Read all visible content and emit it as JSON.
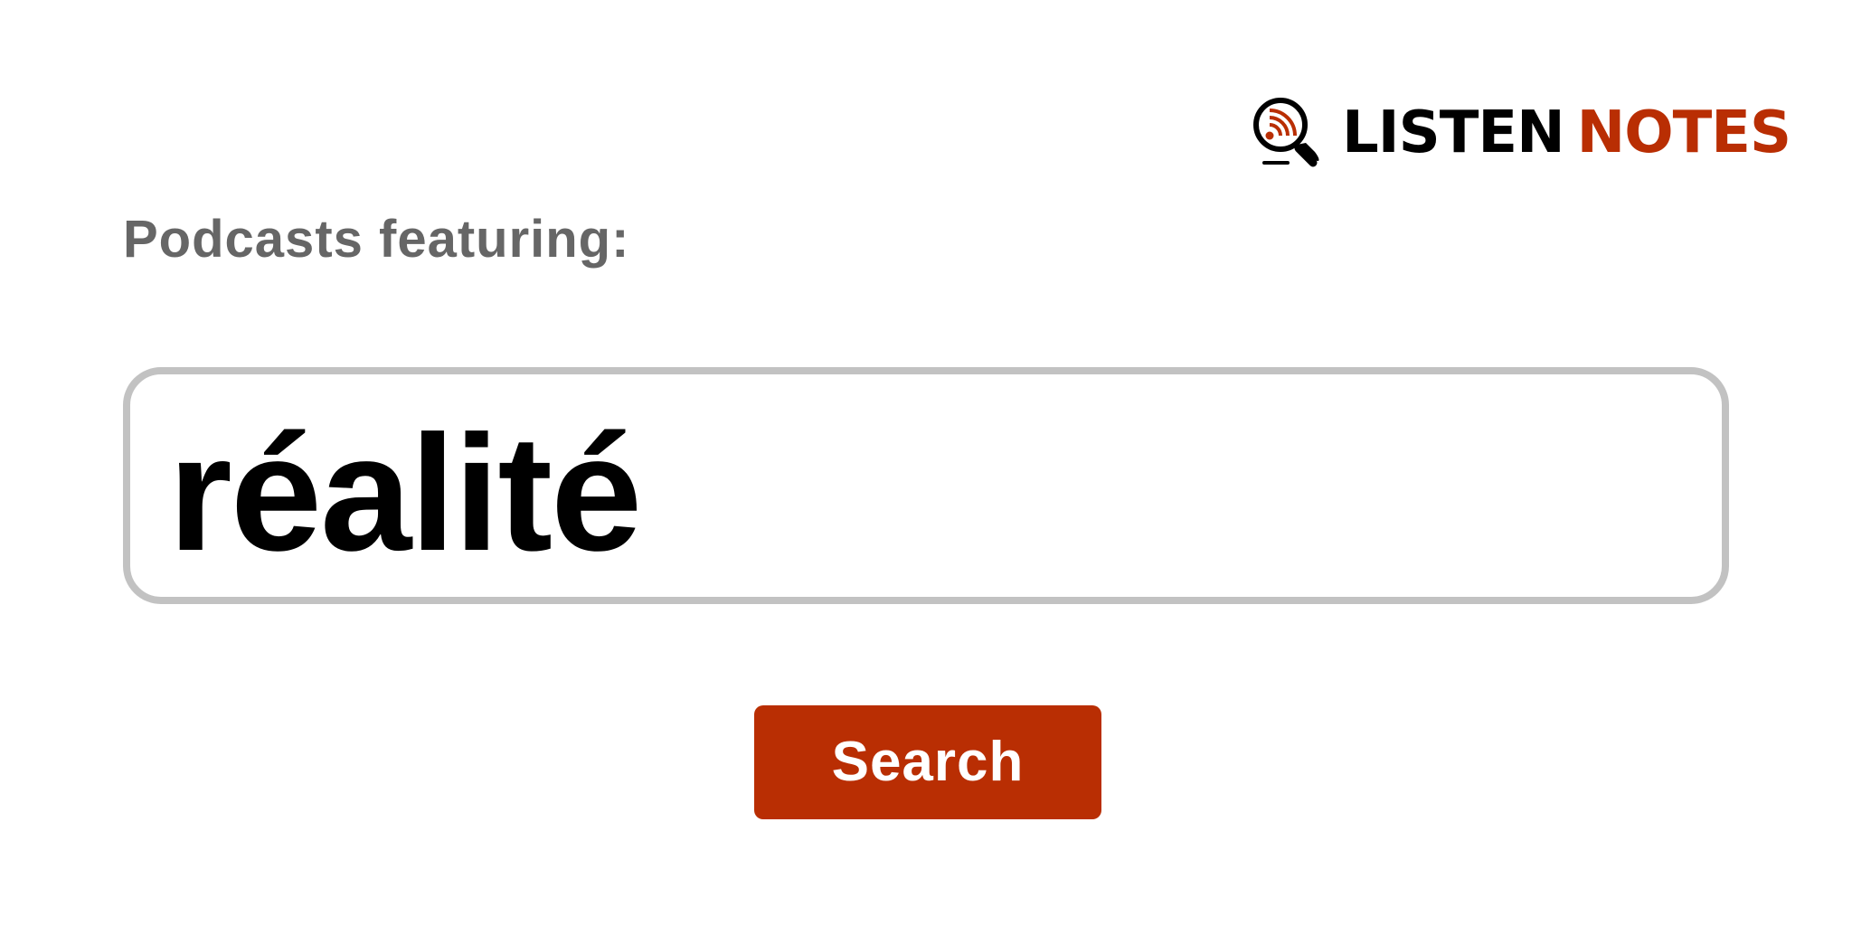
{
  "brand": {
    "word_1": "LISTEN",
    "word_2": "NOTES",
    "icon": "podcast-search-icon",
    "accent_color": "#b92e03"
  },
  "heading": "Podcasts featuring:",
  "search": {
    "value": "réalité",
    "button_label": "Search"
  },
  "colors": {
    "heading": "#666666",
    "input_border": "#c2c2c2",
    "button": "#b92e03",
    "button_text": "#ffffff"
  }
}
